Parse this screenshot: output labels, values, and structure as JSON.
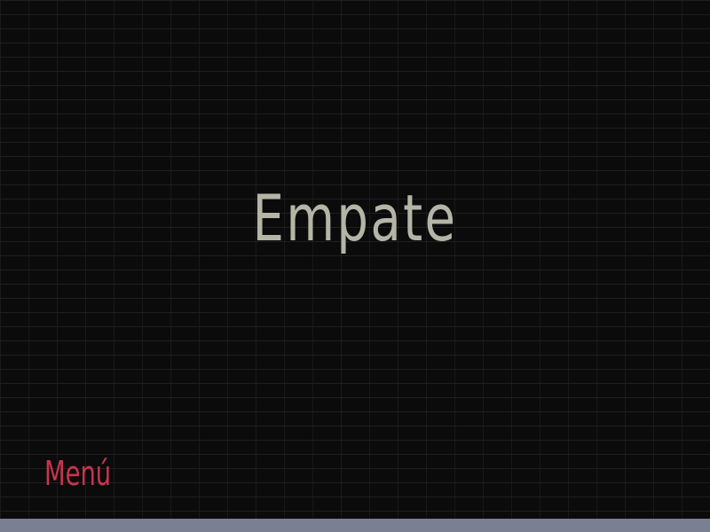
{
  "screen": {
    "title": "Empate",
    "menu_label": "Menú"
  },
  "colors": {
    "background": "#0b0b0b",
    "brick_mortar": "#1f1f1f",
    "title_text": "#b5b5a7",
    "menu_text": "#c8344f",
    "bottom_bar": "#7a8092"
  }
}
